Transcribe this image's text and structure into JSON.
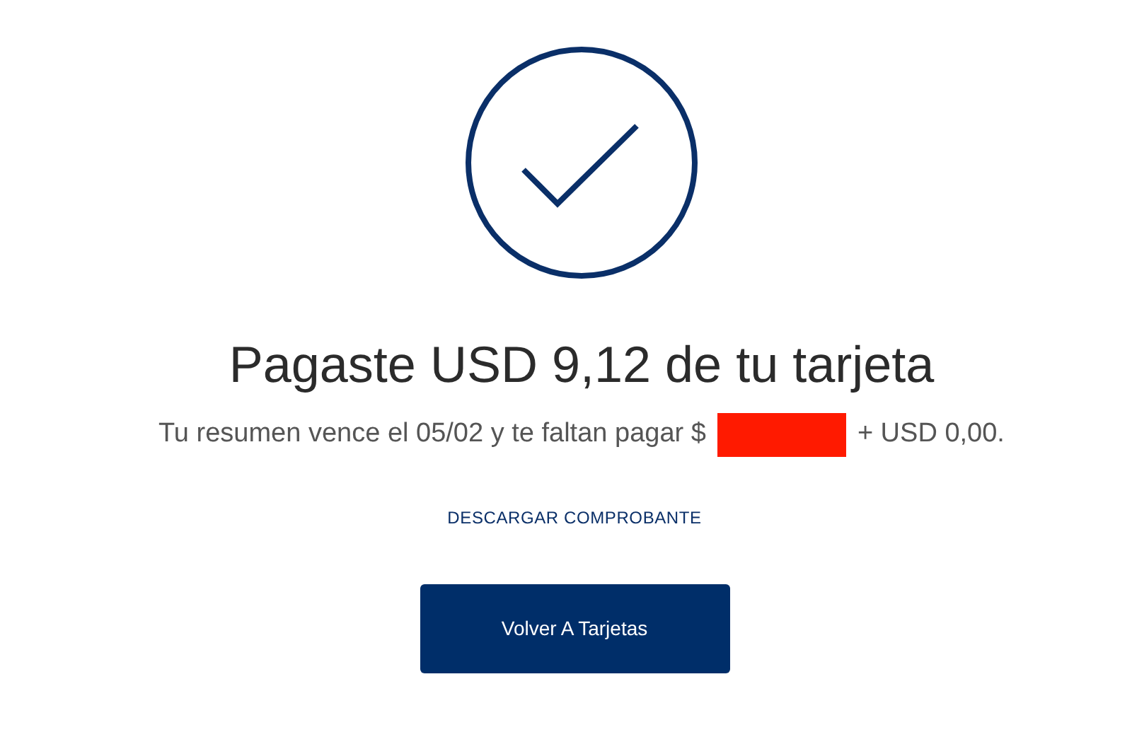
{
  "title": "Pagaste USD 9,12 de tu tarjeta",
  "summary": {
    "before": "Tu resumen vence el 05/02 y te faltan pagar $",
    "redacted": true,
    "after": "+ USD 0,00."
  },
  "download_link": "DESCARGAR COMPROBANTE",
  "button": "Volver A Tarjetas"
}
